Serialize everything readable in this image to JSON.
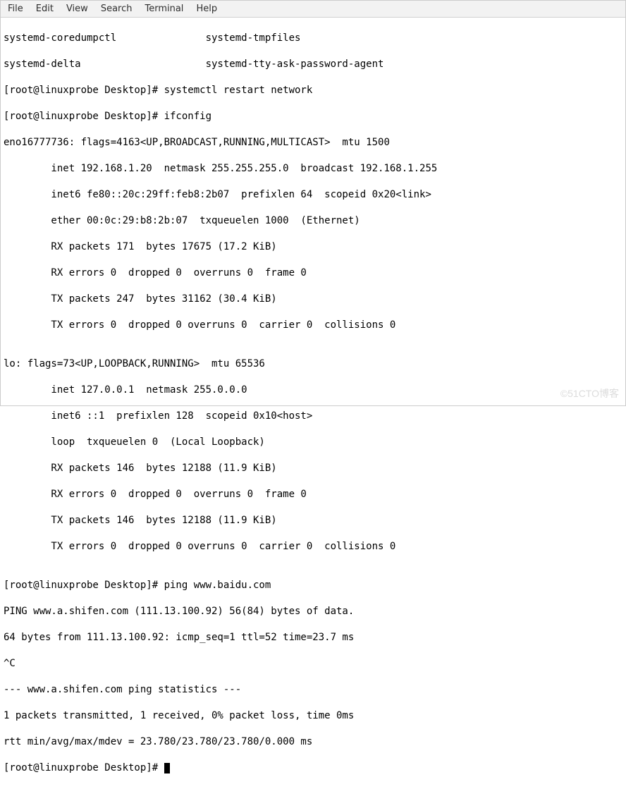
{
  "menubar": {
    "file": "File",
    "edit": "Edit",
    "view": "View",
    "search": "Search",
    "terminal": "Terminal",
    "help": "Help"
  },
  "lines": {
    "l0": "systemd-coredumpctl               systemd-tmpfiles",
    "l1": "systemd-delta                     systemd-tty-ask-password-agent",
    "l2": "[root@linuxprobe Desktop]# systemctl restart network",
    "l3": "[root@linuxprobe Desktop]# ifconfig",
    "l4": "eno16777736: flags=4163<UP,BROADCAST,RUNNING,MULTICAST>  mtu 1500",
    "l5": "        inet 192.168.1.20  netmask 255.255.255.0  broadcast 192.168.1.255",
    "l6": "        inet6 fe80::20c:29ff:feb8:2b07  prefixlen 64  scopeid 0x20<link>",
    "l7": "        ether 00:0c:29:b8:2b:07  txqueuelen 1000  (Ethernet)",
    "l8": "        RX packets 171  bytes 17675 (17.2 KiB)",
    "l9": "        RX errors 0  dropped 0  overruns 0  frame 0",
    "l10": "        TX packets 247  bytes 31162 (30.4 KiB)",
    "l11": "        TX errors 0  dropped 0 overruns 0  carrier 0  collisions 0",
    "l12": "",
    "l13": "lo: flags=73<UP,LOOPBACK,RUNNING>  mtu 65536",
    "l14": "        inet 127.0.0.1  netmask 255.0.0.0",
    "l15": "        inet6 ::1  prefixlen 128  scopeid 0x10<host>",
    "l16": "        loop  txqueuelen 0  (Local Loopback)",
    "l17": "        RX packets 146  bytes 12188 (11.9 KiB)",
    "l18": "        RX errors 0  dropped 0  overruns 0  frame 0",
    "l19": "        TX packets 146  bytes 12188 (11.9 KiB)",
    "l20": "        TX errors 0  dropped 0 overruns 0  carrier 0  collisions 0",
    "l21": "",
    "l22": "[root@linuxprobe Desktop]# ping www.baidu.com",
    "l23": "PING www.a.shifen.com (111.13.100.92) 56(84) bytes of data.",
    "l24": "64 bytes from 111.13.100.92: icmp_seq=1 ttl=52 time=23.7 ms",
    "l25": "^C",
    "l26": "--- www.a.shifen.com ping statistics ---",
    "l27": "1 packets transmitted, 1 received, 0% packet loss, time 0ms",
    "l28": "rtt min/avg/max/mdev = 23.780/23.780/23.780/0.000 ms",
    "l29": "[root@linuxprobe Desktop]# "
  },
  "watermark": "©51CTO博客"
}
